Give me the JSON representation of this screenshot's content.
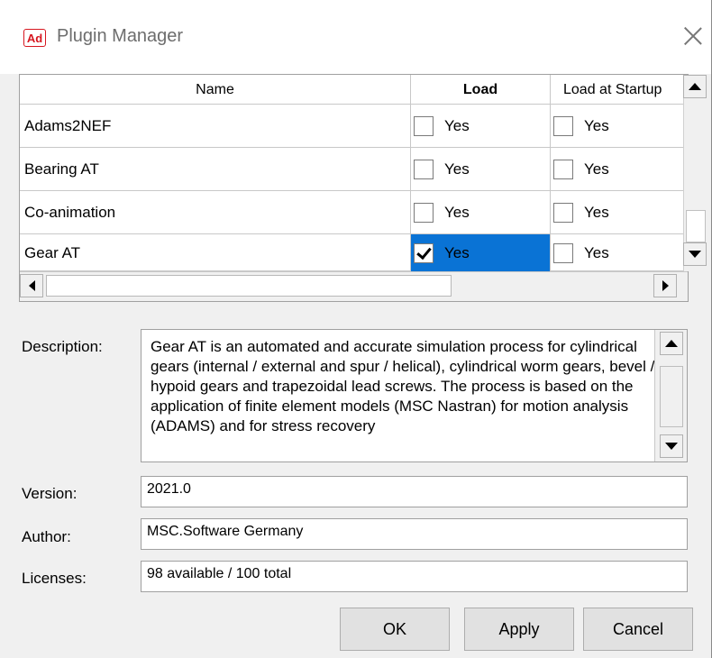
{
  "window": {
    "icon_text": "Ad",
    "title": "Plugin Manager"
  },
  "grid": {
    "columns": [
      "Name",
      "Load",
      "Load at Startup"
    ],
    "rows": [
      {
        "name": "Adams2NEF",
        "load_label": "Yes",
        "load_checked": false,
        "startup_label": "Yes",
        "startup_checked": false
      },
      {
        "name": "Bearing AT",
        "load_label": "Yes",
        "load_checked": false,
        "startup_label": "Yes",
        "startup_checked": false
      },
      {
        "name": "Co-animation",
        "load_label": "Yes",
        "load_checked": false,
        "startup_label": "Yes",
        "startup_checked": false
      },
      {
        "name": "Gear AT",
        "load_label": "Yes",
        "load_checked": true,
        "startup_label": "Yes",
        "startup_checked": false
      }
    ],
    "selection_color": "#0a73d5"
  },
  "details": {
    "description_label": "Description:",
    "description_text": "Gear AT is an automated and accurate simulation process for cylindrical gears (internal / external and spur / helical), cylindrical worm gears, bevel / hypoid gears and trapezoidal lead screws. The process is based on the application of finite element models (MSC Nastran) for motion analysis (ADAMS) and for stress recovery",
    "version_label": "Version:",
    "version_value": "2021.0",
    "author_label": "Author:",
    "author_value": "MSC.Software Germany",
    "licenses_label": "Licenses:",
    "licenses_value": "98 available / 100 total"
  },
  "buttons": {
    "ok": "OK",
    "apply": "Apply",
    "cancel": "Cancel"
  }
}
